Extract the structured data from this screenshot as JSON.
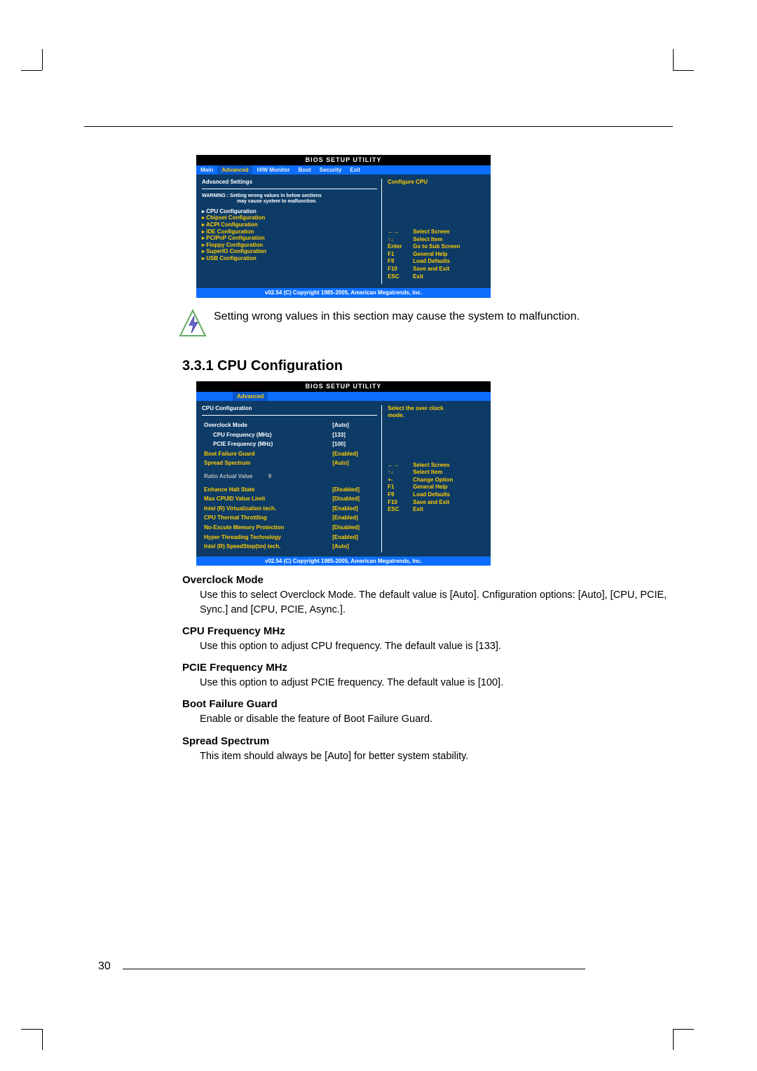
{
  "bios1": {
    "title": "BIOS SETUP UTILITY",
    "tabs": [
      "Main",
      "Advanced",
      "H/W Monitor",
      "Boot",
      "Security",
      "Exit"
    ],
    "heading": "Advanced Settings",
    "warning1": "WARNING : Setting wrong values in below sections",
    "warning2": "may cause system to malfunction.",
    "items": [
      "CPU Configuration",
      "Chipset Configuration",
      "ACPI Configuration",
      "IDE Configuration",
      "PCIPnP Configuration",
      "Floppy Configuration",
      "SuperIO Configuration",
      "USB Configuration"
    ],
    "right_info": "Configure CPU",
    "nav": [
      [
        "←→",
        "Select Screen"
      ],
      [
        "↑↓",
        "Select Item"
      ],
      [
        "Enter",
        "Go to Sub Screen"
      ],
      [
        "F1",
        "General Help"
      ],
      [
        "F9",
        "Load Defaults"
      ],
      [
        "F10",
        "Save and Exit"
      ],
      [
        "ESC",
        "Exit"
      ]
    ],
    "copyright": "v02.54 (C) Copyright 1985-2005, American Megatrends, Inc."
  },
  "warning_note": "Setting wrong values in this section may cause the system to malfunction.",
  "section_title": "3.3.1 CPU Configuration",
  "bios2": {
    "title": "BIOS SETUP UTILITY",
    "tab": "Advanced",
    "heading": "CPU Configuration",
    "rows": [
      {
        "k": "Overclock Mode",
        "v": "[Auto]",
        "cls": "white"
      },
      {
        "k": "CPU Frequency (MHz)",
        "v": "[133]",
        "cls": "indent"
      },
      {
        "k": "PCIE Frequency (MHz)",
        "v": "[100]",
        "cls": "indent"
      },
      {
        "k": "Boot Failure Guard",
        "v": "[Enabled]"
      },
      {
        "k": "Spread Spectrum",
        "v": "[Auto]"
      }
    ],
    "ratio": {
      "k": "Ratio Actual Value",
      "v": "9"
    },
    "rows2": [
      {
        "k": "Enhance Halt State",
        "v": "[Disabled]"
      },
      {
        "k": "Max CPUID Value Limit",
        "v": "[Disabled]"
      },
      {
        "k": "Intel (R) Virtualization tech.",
        "v": "[Enabled]"
      },
      {
        "k": "CPU Thermal Throttling",
        "v": "[Enabled]"
      },
      {
        "k": "No-Excute Memory Protection",
        "v": "[Disabled]"
      },
      {
        "k": "Hyper Threading Technology",
        "v": "[Enabled]"
      },
      {
        "k": "Intel (R) SpeedStep(tm) tech.",
        "v": "[Auto]"
      }
    ],
    "right_info1": "Select the over clock",
    "right_info2": "mode.",
    "nav": [
      [
        "←→",
        "Select Screen"
      ],
      [
        "↑↓",
        "Select Item"
      ],
      [
        "+-",
        "Change Option"
      ],
      [
        "F1",
        "General Help"
      ],
      [
        "F9",
        "Load Defaults"
      ],
      [
        "F10",
        "Save and Exit"
      ],
      [
        "ESC",
        "Exit"
      ]
    ],
    "copyright": "v02.54 (C) Copyright 1985-2005, American Megatrends, Inc."
  },
  "options": [
    {
      "label": "Overclock Mode",
      "desc": "Use this to select Overclock Mode. The default value is [Auto]. Cnfiguration options: [Auto], [CPU, PCIE, Sync.] and [CPU, PCIE, Async.]."
    },
    {
      "label": "CPU Frequency MHz",
      "desc": "Use this option to adjust CPU frequency. The default value is [133]."
    },
    {
      "label": "PCIE Frequency MHz",
      "desc": "Use this option to adjust PCIE frequency. The default value is [100]."
    },
    {
      "label": "Boot Failure Guard",
      "desc": "Enable or disable the feature of Boot Failure Guard."
    },
    {
      "label": "Spread Spectrum",
      "desc": "This item should always be [Auto] for better system stability."
    }
  ],
  "page_number": "30"
}
